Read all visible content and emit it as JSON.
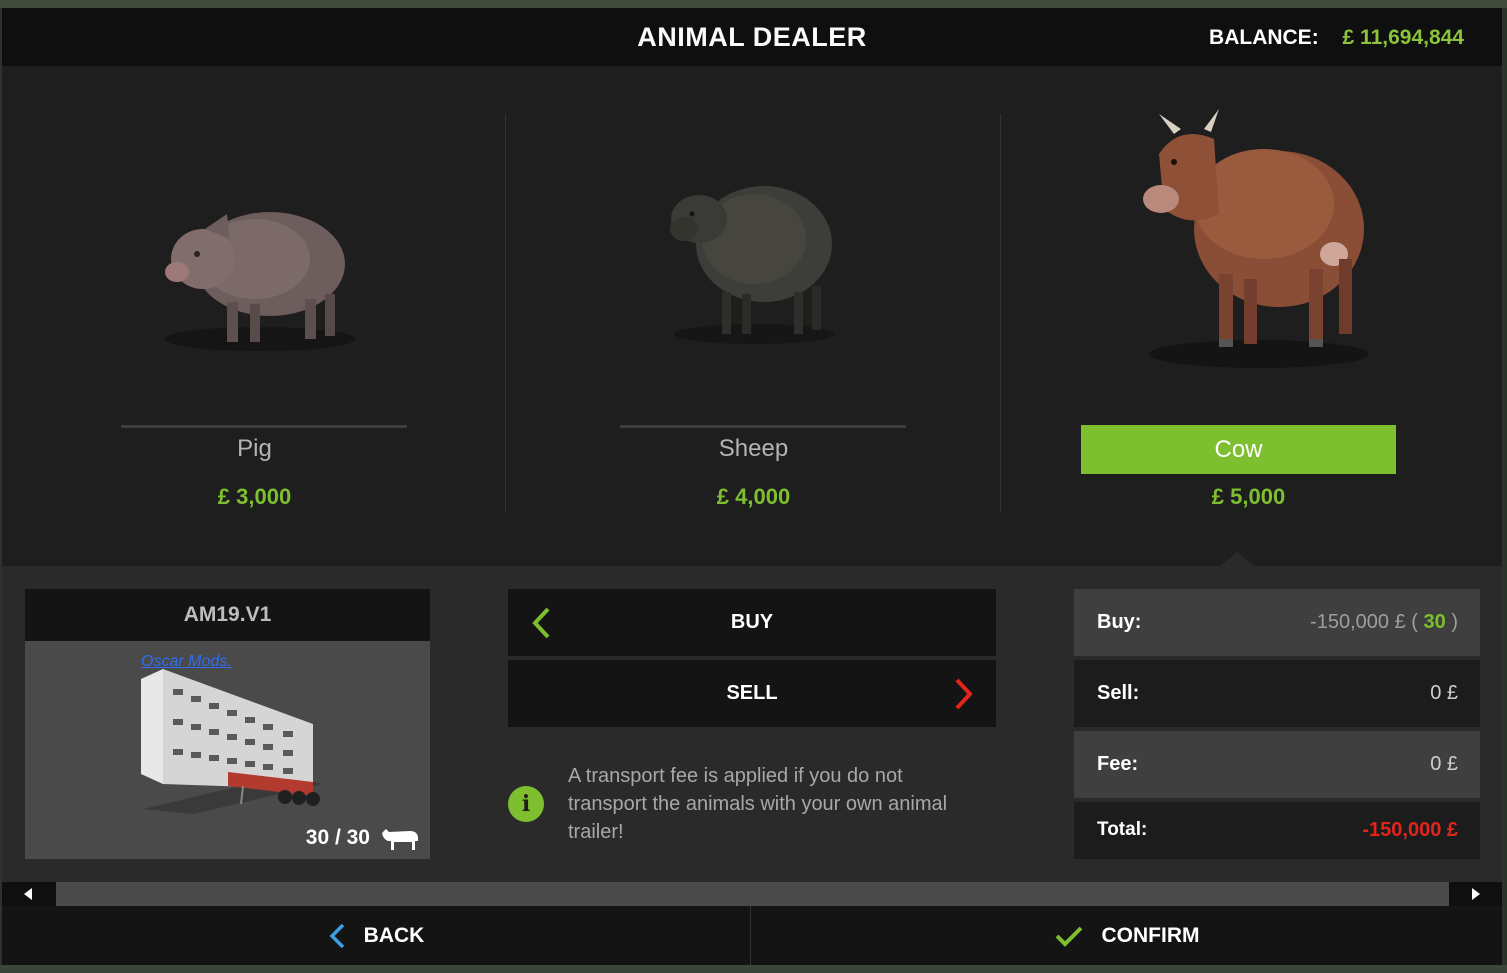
{
  "header": {
    "title": "ANIMAL DEALER",
    "balance_label": "BALANCE:",
    "balance_value": "£ 11,694,844"
  },
  "animals": [
    {
      "name": "Pig",
      "price": "£ 3,000",
      "selected": false
    },
    {
      "name": "Sheep",
      "price": "£ 4,000",
      "selected": false
    },
    {
      "name": "Cow",
      "price": "£ 5,000",
      "selected": true
    }
  ],
  "trailer": {
    "title": "AM19.V1",
    "watermark": "Oscar Mods.",
    "count": "30 / 30",
    "icon": "cow-icon"
  },
  "actions": {
    "buy_label": "BUY",
    "sell_label": "SELL"
  },
  "info": {
    "text": "A transport fee is applied if you do not transport the animals with your own animal trailer!",
    "icon": "info-icon"
  },
  "summary": {
    "buy_label": "Buy:",
    "buy_amount": "-150,000 £ (",
    "buy_count": "30",
    "buy_close": ")",
    "sell_label": "Sell:",
    "sell_value": "0 £",
    "fee_label": "Fee:",
    "fee_value": "0 £",
    "total_label": "Total:",
    "total_value": "-150,000 £"
  },
  "footer": {
    "back_label": "BACK",
    "confirm_label": "CONFIRM"
  },
  "colors": {
    "accent": "#7dbf2f",
    "negative": "#e3241b",
    "back_icon": "#3aa0e0"
  }
}
